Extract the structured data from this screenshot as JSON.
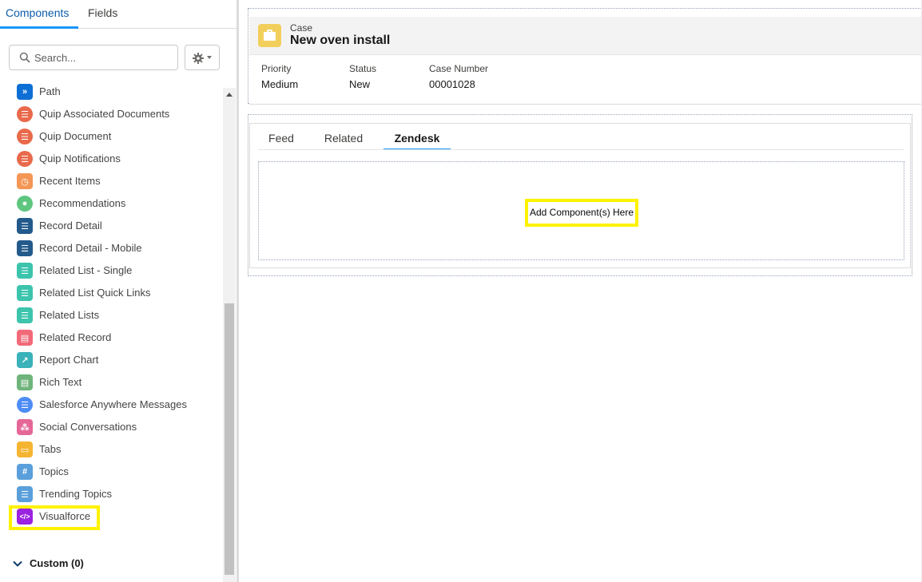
{
  "left_panel": {
    "tabs": [
      {
        "label": "Components",
        "active": true
      },
      {
        "label": "Fields",
        "active": false
      }
    ],
    "search": {
      "placeholder": "Search...",
      "value": ""
    },
    "components": [
      {
        "label": "Path",
        "icon": "path-icon",
        "color": "#0d6fd6"
      },
      {
        "label": "Quip Associated Documents",
        "icon": "quip-icon",
        "color": "#e9694b"
      },
      {
        "label": "Quip Document",
        "icon": "quip-icon",
        "color": "#e9694b"
      },
      {
        "label": "Quip Notifications",
        "icon": "quip-icon",
        "color": "#e9694b"
      },
      {
        "label": "Recent Items",
        "icon": "clock-icon",
        "color": "#f49756"
      },
      {
        "label": "Recommendations",
        "icon": "lightbulb-icon",
        "color": "#5fc67f"
      },
      {
        "label": "Record Detail",
        "icon": "list-icon",
        "color": "#235a8c"
      },
      {
        "label": "Record Detail - Mobile",
        "icon": "list-icon",
        "color": "#235a8c"
      },
      {
        "label": "Related List - Single",
        "icon": "related-list-icon",
        "color": "#3cc4ad"
      },
      {
        "label": "Related List Quick Links",
        "icon": "related-list-icon",
        "color": "#3cc4ad"
      },
      {
        "label": "Related Lists",
        "icon": "related-list-icon",
        "color": "#3cc4ad"
      },
      {
        "label": "Related Record",
        "icon": "related-record-icon",
        "color": "#f26a79"
      },
      {
        "label": "Report Chart",
        "icon": "chart-icon",
        "color": "#3ab2ba"
      },
      {
        "label": "Rich Text",
        "icon": "rich-text-icon",
        "color": "#6fb47b"
      },
      {
        "label": "Salesforce Anywhere Messages",
        "icon": "chat-icon",
        "color": "#4d8cf5"
      },
      {
        "label": "Social Conversations",
        "icon": "social-icon",
        "color": "#e56798"
      },
      {
        "label": "Tabs",
        "icon": "folder-icon",
        "color": "#f5b432"
      },
      {
        "label": "Topics",
        "icon": "hash-icon",
        "color": "#5a9fdb"
      },
      {
        "label": "Trending Topics",
        "icon": "list-lines-icon",
        "color": "#5a9fdb"
      },
      {
        "label": "Visualforce",
        "icon": "code-icon",
        "color": "#9b22e0"
      }
    ],
    "custom_section": {
      "label": "Custom (0)"
    }
  },
  "record_header": {
    "object_name": "Case",
    "record_title": "New oven install",
    "icon": "case-icon",
    "fields": [
      {
        "label": "Priority",
        "value": "Medium"
      },
      {
        "label": "Status",
        "value": "New"
      },
      {
        "label": "Case Number",
        "value": "00001028"
      }
    ]
  },
  "record_tabs": {
    "tabs": [
      {
        "label": "Feed",
        "active": false
      },
      {
        "label": "Related",
        "active": false
      },
      {
        "label": "Zendesk",
        "active": true
      }
    ],
    "drop_zone_label": "Add Component(s) Here"
  },
  "colors": {
    "highlight": "#fff200",
    "accent": "#1b96ff",
    "case_icon": "#f2cf5b"
  }
}
